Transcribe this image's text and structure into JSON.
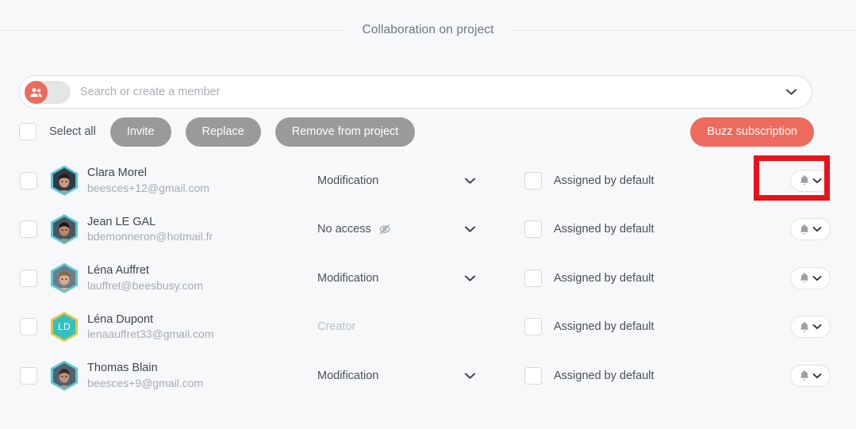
{
  "header": {
    "title": "Collaboration on project"
  },
  "search": {
    "placeholder": "Search or create a member",
    "value": "",
    "toggle_icon": "people-icon",
    "chevron_icon": "chevron-down-icon"
  },
  "toolbar": {
    "select_all_label": "Select all",
    "invite_label": "Invite",
    "replace_label": "Replace",
    "remove_label": "Remove from project",
    "buzz_label": "Buzz subscription"
  },
  "colors": {
    "accent": "#ec6b5c",
    "button_gray": "#9a9a9a",
    "avatar_border": "#56c8d8",
    "avatar_border_creator": "#e8c34a",
    "avatar_initials_bg": "#33c2bd",
    "highlight": "#e8131a",
    "background": "#f7f8f9"
  },
  "highlight": {
    "target": "notification-dropdown-row-1"
  },
  "members": [
    {
      "name": "Clara Morel",
      "email": "beesces+12@gmail.com",
      "access": "Modification",
      "access_icon": "",
      "has_access_dropdown": true,
      "is_creator": false,
      "avatar_type": "photo",
      "avatar_initials": "",
      "assigned_label": "Assigned by default",
      "assigned_checked": false,
      "selected": false,
      "bell_icon": "bell-icon",
      "bell_chevron_icon": "chevron-down-icon"
    },
    {
      "name": "Jean LE GAL",
      "email": "bdemonneron@hotmail.fr",
      "access": "No access",
      "access_icon": "eye-off-icon",
      "has_access_dropdown": true,
      "is_creator": false,
      "avatar_type": "photo",
      "avatar_initials": "",
      "assigned_label": "Assigned by default",
      "assigned_checked": false,
      "selected": false,
      "bell_icon": "bell-icon",
      "bell_chevron_icon": "chevron-down-icon"
    },
    {
      "name": "Léna Auffret",
      "email": "lauffret@beesbusy.com",
      "access": "Modification",
      "access_icon": "",
      "has_access_dropdown": true,
      "is_creator": false,
      "avatar_type": "photo",
      "avatar_initials": "",
      "assigned_label": "Assigned by default",
      "assigned_checked": false,
      "selected": false,
      "bell_icon": "bell-icon",
      "bell_chevron_icon": "chevron-down-icon"
    },
    {
      "name": "Léna Dupont",
      "email": "lenaauffret33@gmail.com",
      "access": "Creator",
      "access_icon": "",
      "has_access_dropdown": false,
      "is_creator": true,
      "avatar_type": "initials",
      "avatar_initials": "LD",
      "assigned_label": "Assigned by default",
      "assigned_checked": false,
      "selected": false,
      "bell_icon": "bell-icon",
      "bell_chevron_icon": "chevron-down-icon"
    },
    {
      "name": "Thomas Blain",
      "email": "beesces+9@gmail.com",
      "access": "Modification",
      "access_icon": "",
      "has_access_dropdown": true,
      "is_creator": false,
      "avatar_type": "photo",
      "avatar_initials": "",
      "assigned_label": "Assigned by default",
      "assigned_checked": false,
      "selected": false,
      "bell_icon": "bell-icon",
      "bell_chevron_icon": "chevron-down-icon"
    }
  ]
}
